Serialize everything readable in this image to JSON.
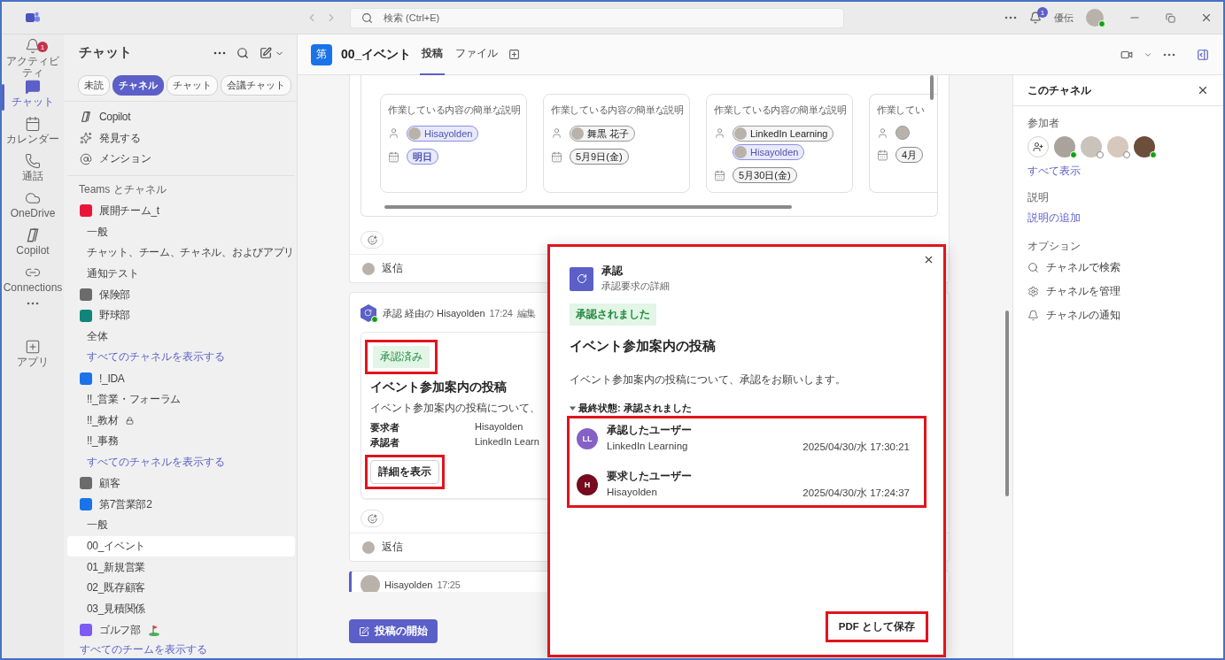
{
  "title_bar": {
    "search_placeholder": "検索 (Ctrl+E)",
    "notification_count": "1",
    "user_name": "優伝"
  },
  "rail": [
    {
      "kind": "bell",
      "label": "アクティビティ",
      "badge": "1",
      "selected": false
    },
    {
      "kind": "chat",
      "label": "チャット",
      "selected": true
    },
    {
      "kind": "calendar",
      "label": "カレンダー",
      "selected": false
    },
    {
      "kind": "phone",
      "label": "通話",
      "selected": false
    },
    {
      "kind": "cloud",
      "label": "OneDrive",
      "selected": false
    },
    {
      "kind": "copilot",
      "label": "Copilot",
      "selected": false
    },
    {
      "kind": "connections",
      "label": "Connections",
      "selected": false
    },
    {
      "kind": "more",
      "selected": false
    },
    {
      "kind": "apps",
      "label": "アプリ",
      "selected": false
    }
  ],
  "sidebar": {
    "title": "チャット",
    "filters": [
      {
        "label": "未読",
        "selected": false
      },
      {
        "label": "チャネル",
        "selected": true
      },
      {
        "label": "チャット",
        "selected": false
      },
      {
        "label": "会議チャット",
        "selected": false
      }
    ],
    "shortcuts": [
      {
        "kind": "copilot",
        "label": "Copilot"
      },
      {
        "kind": "discover",
        "label": "発見する"
      },
      {
        "kind": "mention",
        "label": "メンション"
      }
    ],
    "section_title": "Teams とチャネル",
    "teams": [
      {
        "name": "展開チーム_t",
        "color": "#e8173a",
        "channels": [
          {
            "name": "一般",
            "selected": false
          },
          {
            "name": "チャット、チーム、チャネル、およびアプリ",
            "selected": false
          },
          {
            "name": "通知テスト",
            "selected": false
          }
        ]
      },
      {
        "name": "保険部",
        "color": "#6b6b6b"
      },
      {
        "name": "野球部",
        "color": "#12857a",
        "channels": [
          {
            "name": "全体",
            "selected": false
          }
        ],
        "show_all": "すべてのチャネルを表示する"
      },
      {
        "name": "!_IDA",
        "color": "#1a73e8",
        "channels": [
          {
            "name": "!!_営業・フォーラム",
            "selected": false
          },
          {
            "name": "!!_教材",
            "selected": false,
            "locked": true
          },
          {
            "name": "!!_事務",
            "selected": false
          }
        ],
        "show_all": "すべてのチャネルを表示する"
      },
      {
        "name": "顧客",
        "color": "#6b6b6b"
      },
      {
        "name": "第7営業部2",
        "color": "#1a73e8",
        "channels": [
          {
            "name": "一般",
            "selected": false
          },
          {
            "name": "00_イベント",
            "selected": true
          },
          {
            "name": "01_新規営業",
            "selected": false
          },
          {
            "name": "02_既存顧客",
            "selected": false
          },
          {
            "name": "03_見積関係",
            "selected": false
          }
        ]
      },
      {
        "name": "ゴルフ部",
        "color": "#7c5cf2",
        "golf": true
      }
    ],
    "show_all_teams": "すべてのチームを表示する"
  },
  "channel_header": {
    "avatar": "第",
    "title": "00_イベント",
    "tabs": [
      {
        "label": "投稿",
        "selected": true
      },
      {
        "label": "ファイル",
        "selected": false
      }
    ]
  },
  "board": {
    "cards": [
      {
        "description": "作業している内容の簡単な説明",
        "assignees": [
          {
            "name": "Hisayolden",
            "me": true
          }
        ],
        "due": {
          "label": "明日",
          "highlight": true
        }
      },
      {
        "description": "作業している内容の簡単な説明",
        "assignees": [
          {
            "name": "舞黒 花子",
            "me": false
          }
        ],
        "due": {
          "label": "5月9日(金)",
          "highlight": false
        }
      },
      {
        "description": "作業している内容の簡単な説明",
        "assignees": [
          {
            "name": "LinkedIn Learning",
            "me": false
          },
          {
            "name": "Hisayolden",
            "me": true
          }
        ],
        "due": {
          "label": "5月30日(金)",
          "highlight": false
        }
      },
      {
        "description": "作業してい",
        "assignees": [
          {
            "me": false
          }
        ],
        "due": {
          "label": "4月",
          "highlight": false
        }
      }
    ],
    "reply": "返信"
  },
  "approval_message": {
    "sender": "承認 経由の Hisayolden",
    "time": "17:24",
    "edited": "編集",
    "status": {
      "label": "承認済み",
      "highlighted": true
    },
    "title": "イベント参加案内の投稿",
    "description": "イベント参加案内の投稿について、",
    "fields": [
      {
        "label": "要求者",
        "value": "Hisayolden"
      },
      {
        "label": "承認者",
        "value": "LinkedIn Learn"
      }
    ],
    "details_button": {
      "label": "詳細を表示",
      "highlighted": true
    },
    "reply": "返信"
  },
  "next_message": {
    "sender": "Hisayolden",
    "time": "17:25"
  },
  "compose_button": "投稿の開始",
  "dialog": {
    "highlighted": true,
    "title": "承認",
    "subtitle": "承認要求の詳細",
    "status": "承認されました",
    "heading": "イベント参加案内の投稿",
    "body": "イベント参加案内の投稿について、承認をお願いします。",
    "history": {
      "label": "最終状態: 承認されました",
      "expanded": true,
      "highlighted": true,
      "entries": [
        {
          "initials": "LL",
          "color": "#8661c5",
          "role": "承認したユーザー",
          "name": "LinkedIn Learning",
          "time": "2025/04/30/水 17:30:21"
        },
        {
          "initials": "H",
          "color": "#750b1c",
          "role": "要求したユーザー",
          "name": "Hisayolden",
          "time": "2025/04/30/水 17:24:37"
        }
      ]
    },
    "pdf_button": {
      "label": "PDF として保存",
      "highlighted": true
    }
  },
  "right_panel": {
    "title": "このチャネル",
    "participants_label": "参加者",
    "participants": [
      {
        "online": true
      },
      {
        "online": false
      },
      {
        "online": false
      },
      {
        "online": true
      }
    ],
    "show_all": "すべて表示",
    "description_label": "説明",
    "add_description": "説明の追加",
    "options_label": "オプション",
    "options": [
      {
        "kind": "search",
        "label": "チャネルで検索"
      },
      {
        "kind": "gear",
        "label": "チャネルを管理"
      },
      {
        "kind": "bell",
        "label": "チャネルの通知"
      }
    ]
  }
}
